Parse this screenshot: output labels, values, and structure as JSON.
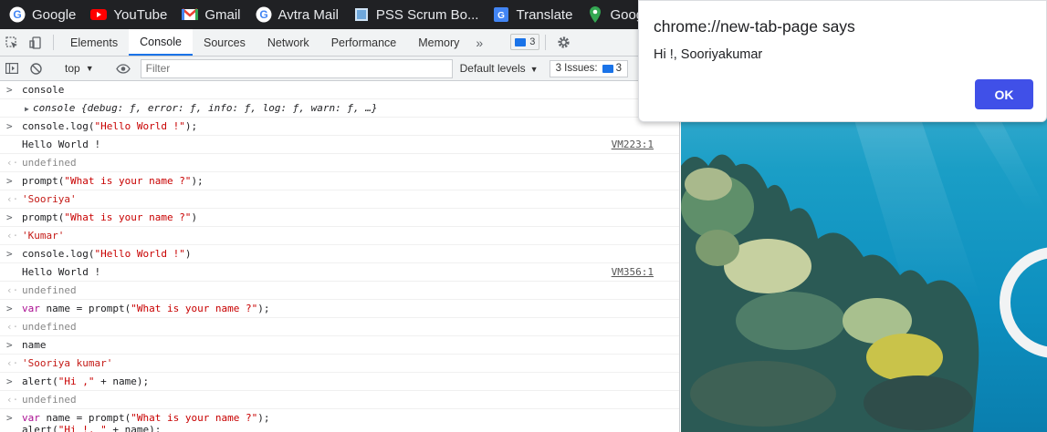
{
  "bookmarks": [
    {
      "label": "Google",
      "icon": "google-icon"
    },
    {
      "label": "YouTube",
      "icon": "youtube-icon"
    },
    {
      "label": "Gmail",
      "icon": "gmail-icon"
    },
    {
      "label": "Avtra Mail",
      "icon": "google-icon"
    },
    {
      "label": "PSS Scrum Bo...",
      "icon": "puzzle-icon"
    },
    {
      "label": "Translate",
      "icon": "translate-icon"
    },
    {
      "label": "Goog",
      "icon": "maps-icon"
    }
  ],
  "devtools": {
    "tabs": [
      "Elements",
      "Console",
      "Sources",
      "Network",
      "Performance",
      "Memory"
    ],
    "active_tab": "Console",
    "more": "»",
    "issue_badge_count": "3"
  },
  "toolbar": {
    "context": "top",
    "filter_placeholder": "Filter",
    "levels": "Default levels",
    "issues_label": "3 Issues:",
    "issues_count": "3"
  },
  "console": {
    "row0": "console",
    "row1": "console {debug: ƒ, error: ƒ, info: ƒ, log: ƒ, warn: ƒ, …}",
    "row2_a": "console.log(",
    "row2_s": "\"Hello World !\"",
    "row2_b": ");",
    "row3": "Hello World !",
    "row3_src": "VM223:1",
    "row4": "undefined",
    "row5_a": "prompt(",
    "row5_s": "\"What is your name ?\"",
    "row5_b": ");",
    "row6": "'Sooriya'",
    "row7_a": "prompt(",
    "row7_s": "\"What is your name ?\"",
    "row7_b": ")",
    "row8": "'Kumar'",
    "row9_a": "console.log(",
    "row9_s": "\"Hello World !\"",
    "row9_b": ")",
    "row10": "Hello World !",
    "row10_src": "VM356:1",
    "row11": "undefined",
    "row12_k": "var",
    "row12_a": " name = prompt(",
    "row12_s": "\"What is your name ?\"",
    "row12_b": ");",
    "row13": "undefined",
    "row14": "name",
    "row15": "'Sooriya kumar'",
    "row16_a": "alert(",
    "row16_s": "\"Hi ,\"",
    "row16_b": " + name);",
    "row17": "undefined",
    "row18_k": "var",
    "row18_a": " name = prompt(",
    "row18_s": "\"What is your name ?\"",
    "row18_b": ");",
    "row18_c": "alert(",
    "row18_s2": "\"Hi !, \"",
    "row18_d": " + name);"
  },
  "dialog": {
    "title": "chrome://new-tab-page says",
    "message": "Hi !, Sooriyakumar",
    "ok_label": "OK"
  },
  "colors": {
    "accent": "#1a73e8",
    "ok_button": "#4050e8",
    "string": "#c80000",
    "keyword": "#aa0d91"
  }
}
